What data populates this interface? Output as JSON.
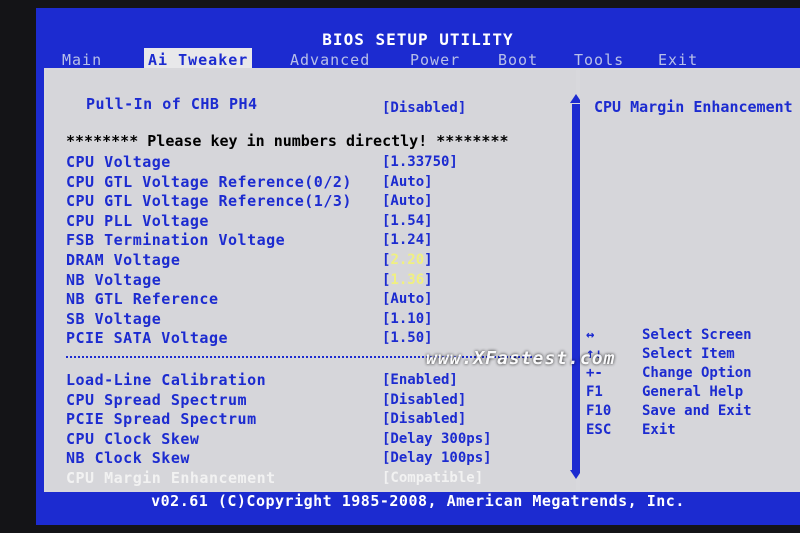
{
  "title": "BIOS SETUP UTILITY",
  "menu": [
    "Main",
    "Ai Tweaker",
    "Advanced",
    "Power",
    "Boot",
    "Tools",
    "Exit"
  ],
  "main": {
    "pullin_label": "Pull-In of CHB PH4",
    "pullin_value": "[Disabled]",
    "note": "******** Please key in numbers directly! ********",
    "items": [
      {
        "label": "CPU Voltage",
        "value": "[1.33750]"
      },
      {
        "label": "CPU GTL Voltage Reference(0/2)",
        "value": "[Auto]"
      },
      {
        "label": "CPU GTL Voltage Reference(1/3)",
        "value": "[Auto]"
      },
      {
        "label": "CPU PLL Voltage",
        "value": "[1.54]"
      },
      {
        "label": "FSB Termination Voltage",
        "value": "[1.24]"
      },
      {
        "label": "DRAM Voltage",
        "value": "[2.20]",
        "highlight": "2.20"
      },
      {
        "label": "NB Voltage",
        "value": "[1.36]",
        "highlight": "1.36"
      },
      {
        "label": "NB GTL Reference",
        "value": "[Auto]"
      },
      {
        "label": "SB Voltage",
        "value": "[1.10]"
      },
      {
        "label": "PCIE SATA Voltage",
        "value": "[1.50]"
      }
    ],
    "items2": [
      {
        "label": "Load-Line Calibration",
        "value": "[Enabled]"
      },
      {
        "label": "CPU Spread Spectrum",
        "value": "[Disabled]"
      },
      {
        "label": "PCIE Spread Spectrum",
        "value": "[Disabled]"
      },
      {
        "label": "CPU Clock Skew",
        "value": "[Delay 300ps]"
      },
      {
        "label": "NB Clock Skew",
        "value": "[Delay 100ps]"
      },
      {
        "label": "CPU Margin Enhancement",
        "value": "[Compatible]"
      }
    ]
  },
  "help": {
    "title": "CPU Margin Enhancement",
    "keys": [
      {
        "key": "↔",
        "action": "Select Screen"
      },
      {
        "key": "↑↓",
        "action": "Select Item"
      },
      {
        "key": "+-",
        "action": "Change Option"
      },
      {
        "key": "F1",
        "action": "General Help"
      },
      {
        "key": "F10",
        "action": "Save and Exit"
      },
      {
        "key": "ESC",
        "action": "Exit"
      }
    ]
  },
  "watermark": "www.XFastest.com",
  "footer": "v02.61 (C)Copyright 1985-2008, American Megatrends, Inc."
}
